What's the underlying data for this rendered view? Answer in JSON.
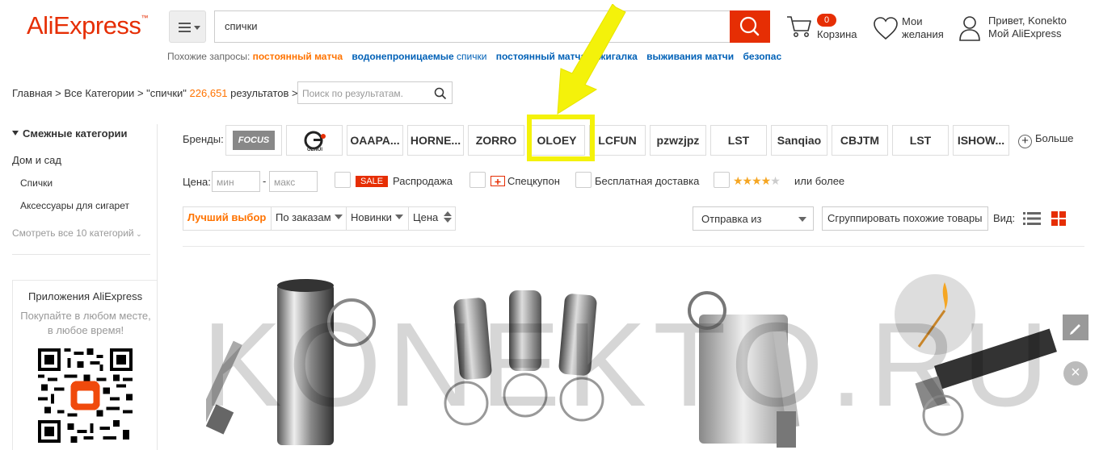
{
  "header": {
    "logo": "AliExpress",
    "search_value": "спички",
    "cart_count": "0",
    "cart_label": "Корзина",
    "wishlist_line1": "Мои",
    "wishlist_line2": "желания",
    "user_line1": "Привет, Konekto",
    "user_line2": "Мой AliExpress"
  },
  "related": {
    "label": "Похожие запросы:",
    "items": [
      {
        "bold": "постоянный матча",
        "rest": "",
        "highlight": true
      },
      {
        "bold": "водонепроницаемые",
        "rest": "спички"
      },
      {
        "bold": "постоянный матча зажигалка",
        "rest": ""
      },
      {
        "bold": "выживания матчи",
        "rest": ""
      },
      {
        "bold": "безопас",
        "rest": ""
      }
    ]
  },
  "breadcrumb": {
    "home": "Главная",
    "all": "Все Категории",
    "query": "\"спички\"",
    "count": "226,651",
    "results": "результатов",
    "in_search_placeholder": "Поиск по результатам."
  },
  "sidebar": {
    "title": "Смежные категории",
    "category": "Дом и сад",
    "sub1": "Спички",
    "sub2": "Аксессуары для сигарет",
    "view_all": "Смотреть все 10 категорий",
    "app_title": "Приложения AliExpress",
    "app_text": "Покупайте в любом месте, в любое время!"
  },
  "brands": {
    "label": "Бренды:",
    "logo1": "FOCUS",
    "logo2": "GENUI",
    "items": [
      "OAAPA...",
      "HORNE...",
      "ZORRO",
      "OLOEY",
      "LCFUN",
      "pzwzjpz",
      "LST",
      "Sanqiao",
      "CBJTM",
      "LST",
      "ISHOW..."
    ],
    "more": "Больше"
  },
  "filters": {
    "price_label": "Цена:",
    "min_placeholder": "мин",
    "max_placeholder": "макс",
    "dash": "-",
    "sale_tag": "SALE",
    "sale_label": "Распродажа",
    "coupon_label": "Спецкупон",
    "free_ship_label": "Бесплатная доставка",
    "rating_stars": 4,
    "rating_label": "или более"
  },
  "sort": {
    "best": "Лучший выбор",
    "orders": "По заказам",
    "new": "Новинки",
    "price": "Цена",
    "ship_from": "Отправка из",
    "group": "Сгруппировать похожие товары",
    "view_label": "Вид:"
  },
  "watermark": "KONEKTO.RU",
  "colors": {
    "accent": "#e62e04",
    "orange": "#ff7300",
    "link": "#0061b7",
    "highlight": "#f4f20a"
  }
}
